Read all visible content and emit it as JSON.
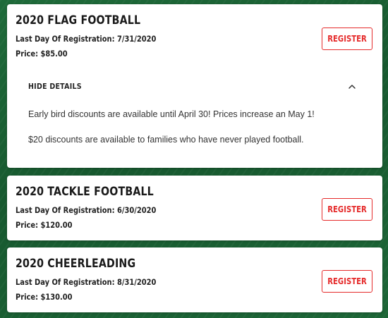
{
  "programs": [
    {
      "title": "2020 FLAG FOOTBALL",
      "registration": "Last Day Of Registration: 7/31/2020",
      "price": "Price: $85.00",
      "register_label": "REGISTER",
      "details_toggle_label": "HIDE DETAILS",
      "details_expanded": true,
      "details": [
        "Early bird discounts are available until April 30! Prices increase an May 1!",
        "$20 discounts are available to families who have never played football."
      ]
    },
    {
      "title": "2020 TACKLE FOOTBALL",
      "registration": "Last Day Of Registration: 6/30/2020",
      "price": "Price: $120.00",
      "register_label": "REGISTER"
    },
    {
      "title": "2020 CHEERLEADING",
      "registration": "Last Day Of Registration: 8/31/2020",
      "price": "Price: $130.00",
      "register_label": "REGISTER"
    }
  ],
  "colors": {
    "accent": "#e52b2b",
    "background": "#1d6637",
    "card": "#ffffff"
  },
  "icons": {
    "collapse": "chevron-up-icon"
  }
}
